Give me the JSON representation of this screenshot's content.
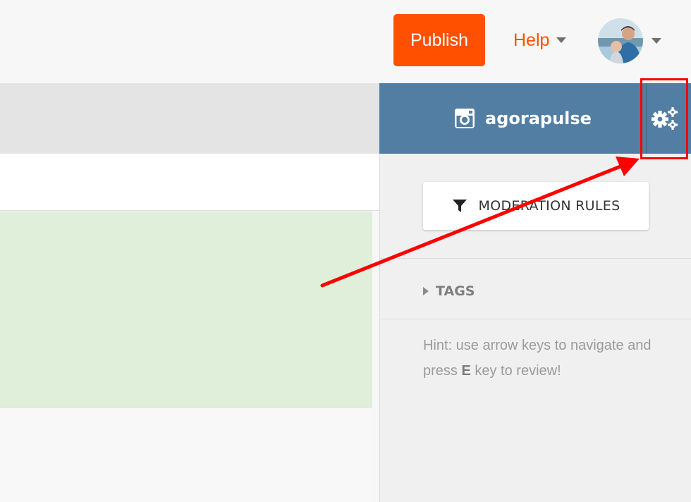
{
  "header": {
    "publish_label": "Publish",
    "help_label": "Help"
  },
  "account": {
    "network_icon": "instagram-icon",
    "name": "agorapulse",
    "settings_icon": "gears-icon"
  },
  "panel": {
    "moderation_label": "MODERATION RULES",
    "tags_label": "TAGS",
    "hint_part1": "Hint: use arrow keys to navigate and press ",
    "hint_key": "E",
    "hint_part2": " key to review!"
  },
  "colors": {
    "publish": "#ff5000",
    "help": "#ff5000",
    "account_header": "#527ea3",
    "selected_row": "#dfefda",
    "annotation": "#ff0000"
  }
}
